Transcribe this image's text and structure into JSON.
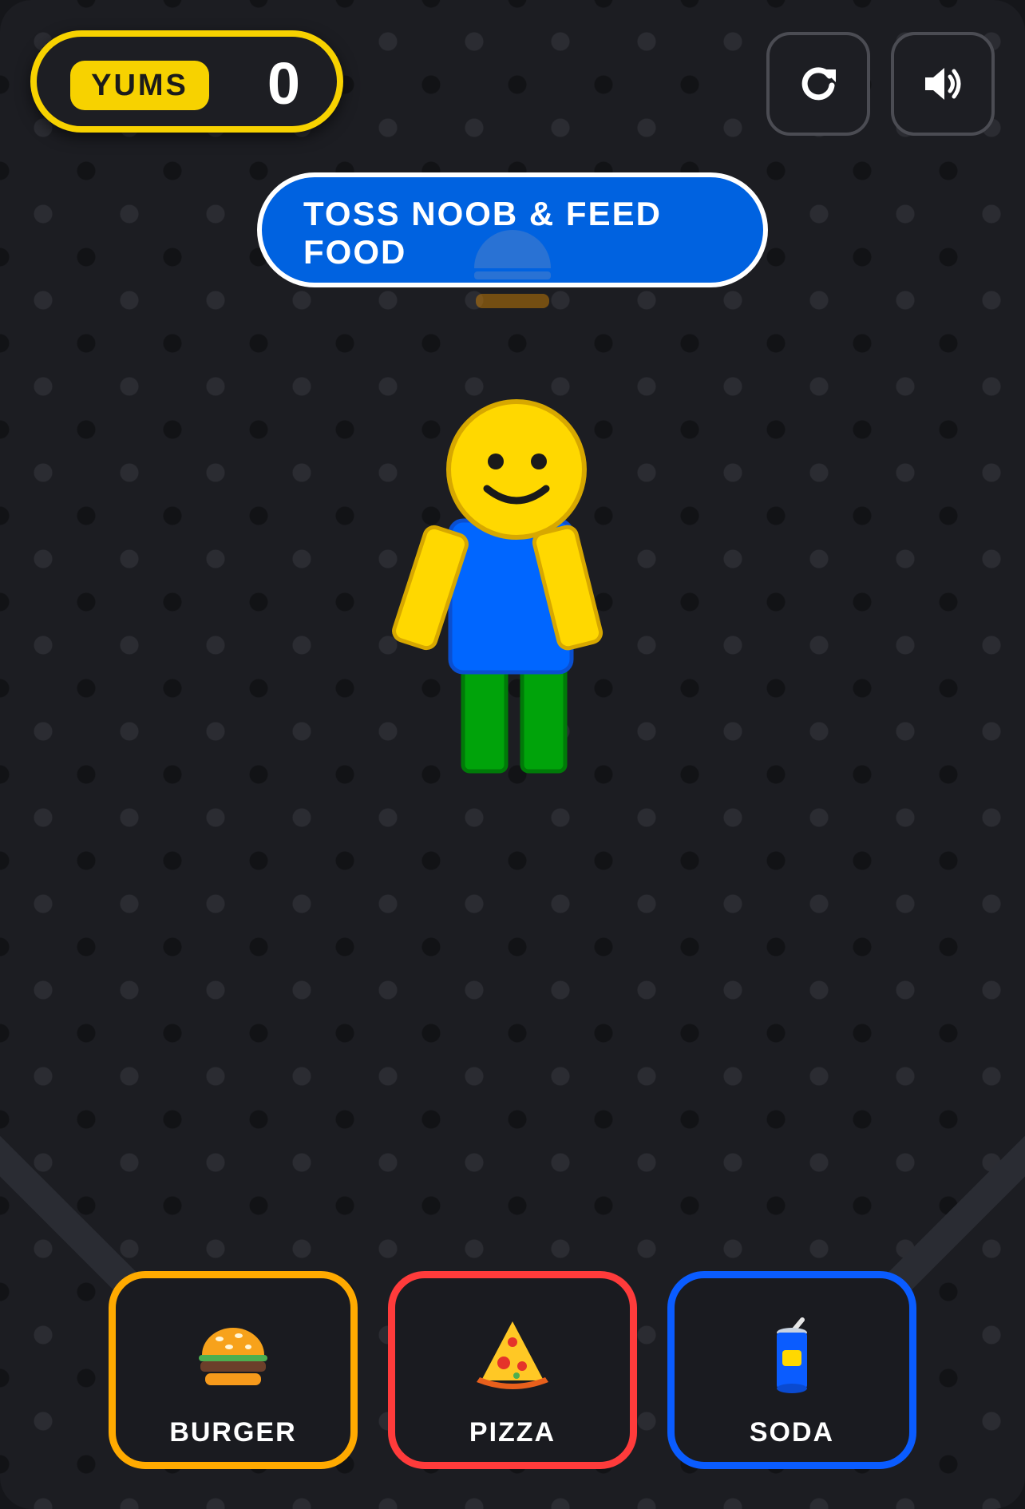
{
  "score": {
    "label": "YUMS",
    "value": "0"
  },
  "buttons": {
    "restart_icon": "restart-icon",
    "sound_icon": "speaker-icon"
  },
  "banner": {
    "text": "TOSS NOOB & FEED FOOD"
  },
  "character": {
    "name": "noob",
    "head_color": "#ffd800",
    "torso_color": "#0066ff",
    "leg_color": "#00a30a"
  },
  "foods": [
    {
      "label": "BURGER",
      "icon": "burger-icon",
      "color": "#ffaa00"
    },
    {
      "label": "PIZZA",
      "icon": "pizza-icon",
      "color": "#ff3b3b"
    },
    {
      "label": "SODA",
      "icon": "soda-icon",
      "color": "#0a5cff"
    }
  ],
  "colors": {
    "accent_yellow": "#f7d200",
    "banner_blue": "#0062e0",
    "background": "#1c1d22"
  }
}
